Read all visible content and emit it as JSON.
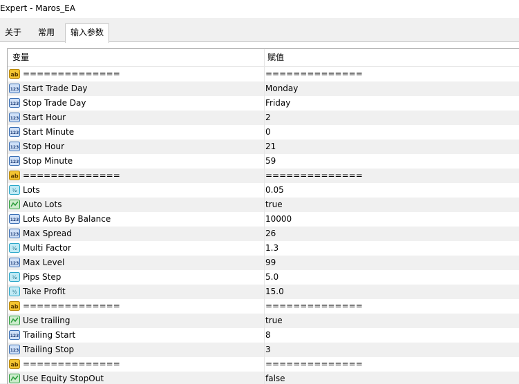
{
  "window": {
    "title": "Expert - Maros_EA"
  },
  "tabs": [
    {
      "label": "关于",
      "active": false
    },
    {
      "label": "常用",
      "active": false
    },
    {
      "label": "输入参数",
      "active": true
    }
  ],
  "grid": {
    "columns": {
      "variable": "变量",
      "value": "赋值"
    },
    "rows": [
      {
        "icon": "ab-string-icon",
        "name": "==============",
        "value": " =============="
      },
      {
        "icon": "123-integer-icon",
        "name": "Start Trade Day",
        "value": "Monday"
      },
      {
        "icon": "123-integer-icon",
        "name": "Stop Trade Day",
        "value": "Friday"
      },
      {
        "icon": "123-integer-icon",
        "name": "Start Hour",
        "value": "2"
      },
      {
        "icon": "123-integer-icon",
        "name": "Start Minute",
        "value": "0"
      },
      {
        "icon": "123-integer-icon",
        "name": "Stop Hour",
        "value": "21"
      },
      {
        "icon": "123-integer-icon",
        "name": "Stop Minute",
        "value": "59"
      },
      {
        "icon": "ab-string-icon",
        "name": "==============",
        "value": " =============="
      },
      {
        "icon": "half-double-icon",
        "name": "Lots",
        "value": "0.05"
      },
      {
        "icon": "bool-toggle-icon",
        "name": "Auto Lots",
        "value": "true"
      },
      {
        "icon": "123-integer-icon",
        "name": "Lots Auto By Balance",
        "value": "10000"
      },
      {
        "icon": "123-integer-icon",
        "name": "Max Spread",
        "value": "26"
      },
      {
        "icon": "half-double-icon",
        "name": "Multi Factor",
        "value": "1.3"
      },
      {
        "icon": "123-integer-icon",
        "name": "Max Level",
        "value": "99"
      },
      {
        "icon": "half-double-icon",
        "name": "Pips Step",
        "value": "5.0"
      },
      {
        "icon": "half-double-icon",
        "name": "Take Profit",
        "value": "15.0"
      },
      {
        "icon": "ab-string-icon",
        "name": "==============",
        "value": " =============="
      },
      {
        "icon": "bool-toggle-icon",
        "name": "Use trailing",
        "value": "true"
      },
      {
        "icon": "123-integer-icon",
        "name": "Trailing Start",
        "value": "8"
      },
      {
        "icon": "123-integer-icon",
        "name": "Trailing Stop",
        "value": "3"
      },
      {
        "icon": "ab-string-icon",
        "name": "==============",
        "value": " =============="
      },
      {
        "icon": "bool-toggle-icon",
        "name": "Use Equity StopOut",
        "value": "false"
      }
    ]
  },
  "colors": {
    "row_alt": "#f0f0f0",
    "grid_line": "#e6e6e6",
    "ab_icon": "#f4c430",
    "int_icon": "#3a6fb5",
    "double_icon": "#2aa7c9",
    "bool_icon": "#2e9e3e"
  }
}
